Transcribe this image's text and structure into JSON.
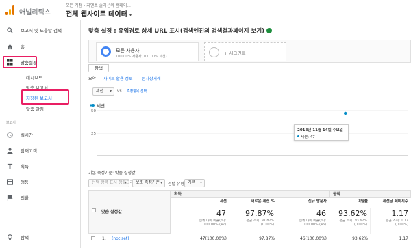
{
  "header": {
    "app_name": "애널리틱스",
    "account_path": "모든 계정 › 지앤소 솔라션의 홈페이...",
    "view_name": "전체 웹사이트 데이터",
    "brand_colors": [
      "#f9ab00",
      "#e37400",
      "#e37400"
    ]
  },
  "sidebar": {
    "search_label": "보고서 및 도움말 검색",
    "home_label": "홈",
    "customization_label": "맞춤설정",
    "sub_items": [
      "대시보드",
      "맞춤 보고서",
      "저장된 보고서",
      "맞춤 알림"
    ],
    "section_reports": "보고서",
    "realtime_label": "실시간",
    "audience_label": "잠재고객",
    "acquisition_label": "획득",
    "behavior_label": "행동",
    "conversions_label": "전환",
    "discover_label": "탐색",
    "highlight_color": "#e91e63"
  },
  "report": {
    "title": "맞춤 설정 : 유입경로 상세 URL 표시(검색엔진의 검색결과페이지 보기)",
    "segment_name": "모든 사용자",
    "segment_sub": "100.00% 사용자(100.00% 세션)",
    "add_segment": "+ 세그먼트",
    "tab_label": "탐색",
    "subtabs": [
      "요약",
      "사이트 활용 정보",
      "전자상거래"
    ],
    "controls": {
      "metric": "세션",
      "vs": "vs.",
      "select_metric": "측정항목 선택"
    },
    "legend": "세션",
    "tooltip_date": "2018년 11월 14일 수요일",
    "tooltip_value": "세션: 47",
    "dimension_label": "기본 측정기준:",
    "dimension_value": "맞춤 설정값",
    "tools": {
      "plot_rows": "선택 항목 표시 행렬그리기",
      "secondary_dim": "보조 측정기준",
      "sort_type": "정렬 유형:",
      "sort_value": "기본"
    }
  },
  "chart_data": {
    "type": "line",
    "series": [
      {
        "name": "세션",
        "points": [
          {
            "x": "2018년 11월 14일",
            "y": 47
          }
        ]
      }
    ],
    "y_ticks": [
      25,
      50
    ],
    "x_tick_labels": [
      "2018년 11월 14일 수요일"
    ],
    "ylim": [
      0,
      50
    ],
    "line_color": "#058dc7"
  },
  "table": {
    "dimension_header": "맞춤 설정값",
    "groups": [
      "획득",
      "동작"
    ],
    "metrics": [
      "세션",
      "새로운 세션 %",
      "신규 방문자",
      "이탈률",
      "세션당 페이지수"
    ],
    "totals": [
      {
        "big": "47",
        "small1": "전체 대비 비율(%):",
        "small2": "100.00% (47)"
      },
      {
        "big": "97.87%",
        "small1": "평균 조회: 97.87%",
        "small2": "(0.00%)"
      },
      {
        "big": "46",
        "small1": "전체 대비 비율(%):",
        "small2": "100.00% (46)"
      },
      {
        "big": "93.62%",
        "small1": "평균 조회: 93.62%",
        "small2": "(0.00%)"
      },
      {
        "big": "1.17",
        "small1": "평균 조회: 1.17",
        "small2": "(0.00%)"
      }
    ],
    "rows": [
      {
        "index": "1.",
        "dimension": "(not set)",
        "values": [
          "47(100.00%)",
          "97.87%",
          "46(100.00%)",
          "93.62%",
          "1.17"
        ]
      }
    ]
  }
}
